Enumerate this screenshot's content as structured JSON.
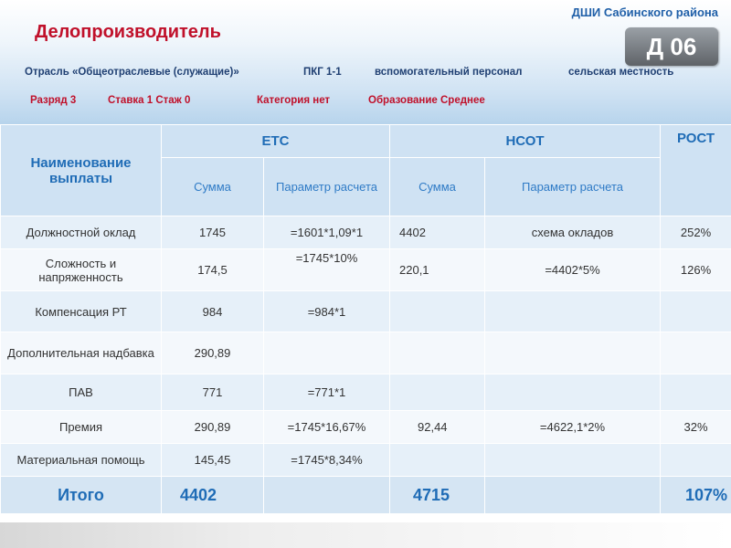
{
  "header": {
    "org": "ДШИ Сабинского района",
    "title": "Делопроизводитель",
    "code": "Д 06",
    "industry": "Отрасль «Общеотраслевые (служащие)»",
    "pkg": "ПКГ 1-1",
    "staff": "вспомогательный персонал",
    "area": "сельская местность",
    "rank": "Разряд 3",
    "rate_exp": "Ставка 1  Стаж 0",
    "category": "Категория нет",
    "education": "Образование Среднее"
  },
  "table": {
    "name_header": "Наименование выплаты",
    "ets": "ЕТС",
    "nsot": "НСОТ",
    "rost": "РОСТ",
    "sum": "Сумма",
    "param": "Параметр расчета",
    "param_nsot": "Параметр расчета",
    "rows": [
      {
        "name": "Должностной оклад",
        "ets_sum": "1745",
        "ets_param": "=1601*1,09*1",
        "nsot_sum": "4402",
        "nsot_param": "схема окладов",
        "rost": "252%"
      },
      {
        "name": "Сложность и напряженность",
        "ets_sum": "174,5",
        "ets_param": "=1745*10%",
        "nsot_sum": "220,1",
        "nsot_param": "=4402*5%",
        "rost": "126%"
      },
      {
        "name": "Компенсация РТ",
        "ets_sum": "984",
        "ets_param": "=984*1",
        "nsot_sum": "",
        "nsot_param": "",
        "rost": ""
      },
      {
        "name": "Дополнительная надбавка",
        "ets_sum": "290,89",
        "ets_param": "",
        "nsot_sum": "",
        "nsot_param": "",
        "rost": ""
      },
      {
        "name": "ПАВ",
        "ets_sum": "771",
        "ets_param": "=771*1",
        "nsot_sum": "",
        "nsot_param": "",
        "rost": ""
      },
      {
        "name": "Премия",
        "ets_sum": "290,89",
        "ets_param": "=1745*16,67%",
        "nsot_sum": "92,44",
        "nsot_param": "=4622,1*2%",
        "rost": "32%"
      },
      {
        "name": "Материальная помощь",
        "ets_sum": "145,45",
        "ets_param": "=1745*8,34%",
        "nsot_sum": "",
        "nsot_param": "",
        "rost": ""
      }
    ],
    "total": {
      "label": "Итого",
      "ets_sum": "4402",
      "nsot_sum": "4715",
      "rost": "107%"
    }
  }
}
